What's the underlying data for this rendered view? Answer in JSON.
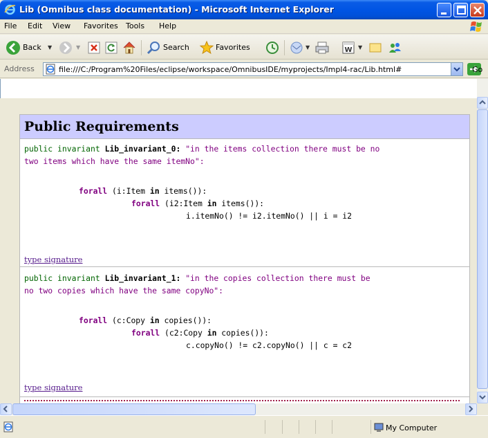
{
  "window": {
    "title": "Lib (Omnibus class documentation) - Microsoft Internet Explorer"
  },
  "menu": {
    "items": [
      "File",
      "Edit",
      "View",
      "Favorites",
      "Tools",
      "Help"
    ]
  },
  "toolbar": {
    "back_label": "Back",
    "search_label": "Search",
    "favorites_label": "Favorites"
  },
  "address": {
    "label": "Address",
    "url": "file:///C:/Program%20Files/eclipse/workspace/OmnibusIDE/myprojects/Impl4-rac/Lib.html#",
    "go_label": "Go"
  },
  "document": {
    "section_title": "Public Requirements",
    "invariants": [
      {
        "keyword": "public invariant",
        "name": "Lib_invariant_0:",
        "desc_line1": "\"in the items collection there must be no",
        "desc_line2": "two items which have the same itemNo\":",
        "forall1_kw": "forall",
        "forall1_rest": " (i:Item ",
        "in1_kw": "in",
        "forall1_tail": " items()):",
        "forall2_kw": "forall",
        "forall2_rest": " (i2:Item ",
        "in2_kw": "in",
        "forall2_tail": " items()):",
        "body": "i.itemNo() != i2.itemNo() || i = i2",
        "link": "type signature"
      },
      {
        "keyword": "public invariant",
        "name": "Lib_invariant_1:",
        "desc_line1": "\"in the copies collection there must be",
        "desc_line2": "no two copies which have the same copyNo\":",
        "forall1_kw": "forall",
        "forall1_rest": " (c:Copy ",
        "in1_kw": "in",
        "forall1_tail": " copies()):",
        "forall2_kw": "forall",
        "forall2_rest": " (c2:Copy ",
        "in2_kw": "in",
        "forall2_tail": " copies()):",
        "body": "c.copyNo() != c2.copyNo() || c = c2",
        "link": "type signature"
      }
    ]
  },
  "status": {
    "zone": "My Computer"
  }
}
